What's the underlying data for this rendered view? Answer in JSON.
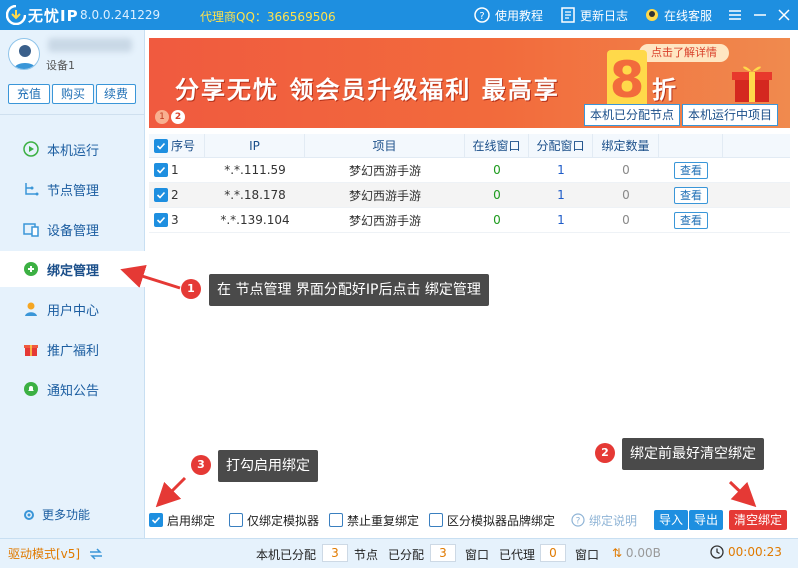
{
  "app": {
    "name": "无忧IP",
    "version": "8.0.0.241229",
    "agent": "代理商QQ：366569506"
  },
  "titlebar": {
    "tutorial": "使用教程",
    "changelog": "更新日志",
    "support": "在线客服"
  },
  "account": {
    "name": "",
    "device": "设备1",
    "buttons": [
      "充值",
      "购买",
      "续费"
    ]
  },
  "nav": {
    "items": [
      {
        "label": "本机运行",
        "icon": "play-circle-icon"
      },
      {
        "label": "节点管理",
        "icon": "node-tree-icon"
      },
      {
        "label": "设备管理",
        "icon": "device-icon"
      },
      {
        "label": "绑定管理",
        "icon": "link-icon"
      },
      {
        "label": "用户中心",
        "icon": "user-icon"
      },
      {
        "label": "推广福利",
        "icon": "gift-icon"
      },
      {
        "label": "通知公告",
        "icon": "bell-icon"
      }
    ],
    "active": "绑定管理",
    "more": "更多功能"
  },
  "banner": {
    "title": "分享无忧 领会员升级福利 最高享",
    "highlight": "8",
    "suffix": "折",
    "more_link": "点击了解详情",
    "pages": [
      "1",
      "2"
    ]
  },
  "tabs": [
    "本机已分配节点",
    "本机运行中项目"
  ],
  "table": {
    "headers": [
      "序号",
      "IP",
      "项目",
      "在线窗口",
      "分配窗口",
      "绑定数量",
      ""
    ],
    "rows": [
      {
        "no": "1",
        "ip": "*.*.111.59",
        "project": "梦幻西游手游",
        "online": "0",
        "assigned": "1",
        "bound": "0",
        "action": "查看"
      },
      {
        "no": "2",
        "ip": "*.*.18.178",
        "project": "梦幻西游手游",
        "online": "0",
        "assigned": "1",
        "bound": "0",
        "action": "查看"
      },
      {
        "no": "3",
        "ip": "*.*.139.104",
        "project": "梦幻西游手游",
        "online": "0",
        "assigned": "1",
        "bound": "0",
        "action": "查看"
      }
    ]
  },
  "annotations": [
    {
      "num": "1",
      "text": "在 节点管理 界面分配好IP后点击 绑定管理"
    },
    {
      "num": "2",
      "text": "绑定前最好清空绑定"
    },
    {
      "num": "3",
      "text": "打勾启用绑定"
    }
  ],
  "options": {
    "enable_bind": {
      "label": "启用绑定",
      "checked": true
    },
    "only_emulator": {
      "label": "仅绑定模拟器",
      "checked": false
    },
    "no_repeat": {
      "label": "禁止重复绑定",
      "checked": false
    },
    "brand_distinguish": {
      "label": "区分模拟器品牌绑定",
      "checked": false
    },
    "help": "绑定说明",
    "import": "导入",
    "export": "导出",
    "clear": "清空绑定"
  },
  "status": {
    "mode": "驱动模式[v5]",
    "assigned_label": "本机已分配",
    "assigned_value": "3",
    "node_label": "节点",
    "assigned2_label": "已分配",
    "assigned2_value": "3",
    "window_label": "窗口",
    "proxy_label": "已代理",
    "proxy_value": "0",
    "window2_label": "窗口",
    "speed": "0.00B",
    "time": "00:00:23"
  },
  "colors": {
    "primary": "#1e8fe0",
    "sidebar_bg": "#e6f2fc",
    "accent_orange": "#e07a00",
    "danger": "#e53935"
  }
}
